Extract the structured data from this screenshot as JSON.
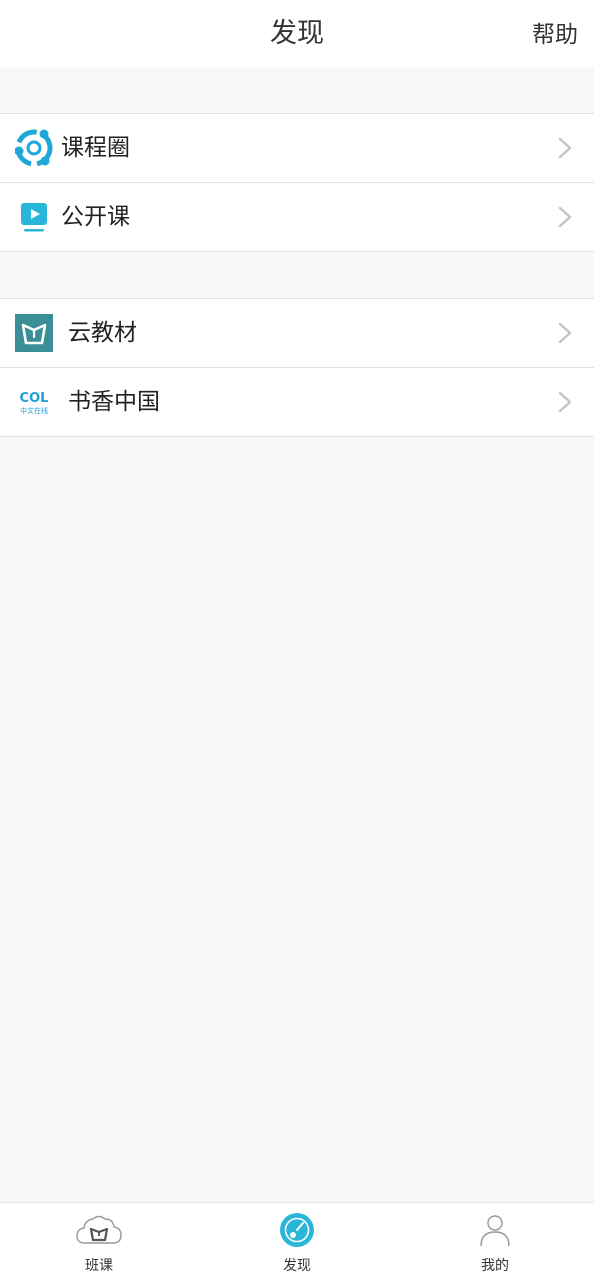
{
  "header": {
    "title": "发现",
    "help_label": "帮助"
  },
  "groups": [
    {
      "items": [
        {
          "label": "课程圈",
          "icon": "course-circle-icon"
        },
        {
          "label": "公开课",
          "icon": "open-course-icon"
        }
      ]
    },
    {
      "items": [
        {
          "label": "云教材",
          "icon": "cloud-textbook-icon"
        },
        {
          "label": "书香中国",
          "icon": "col-logo-icon",
          "icon_text": "COL",
          "icon_subtext": "中文在线"
        }
      ]
    }
  ],
  "tabbar": {
    "tabs": [
      {
        "label": "班课",
        "icon": "cloud-book-icon",
        "active": false
      },
      {
        "label": "发现",
        "icon": "compass-icon",
        "active": true
      },
      {
        "label": "我的",
        "icon": "person-icon",
        "active": false
      }
    ]
  },
  "colors": {
    "accent": "#29b6d8",
    "textbook_teal": "#3a8e96",
    "background": "#f8f8f8",
    "divider": "#e2e2e2"
  }
}
